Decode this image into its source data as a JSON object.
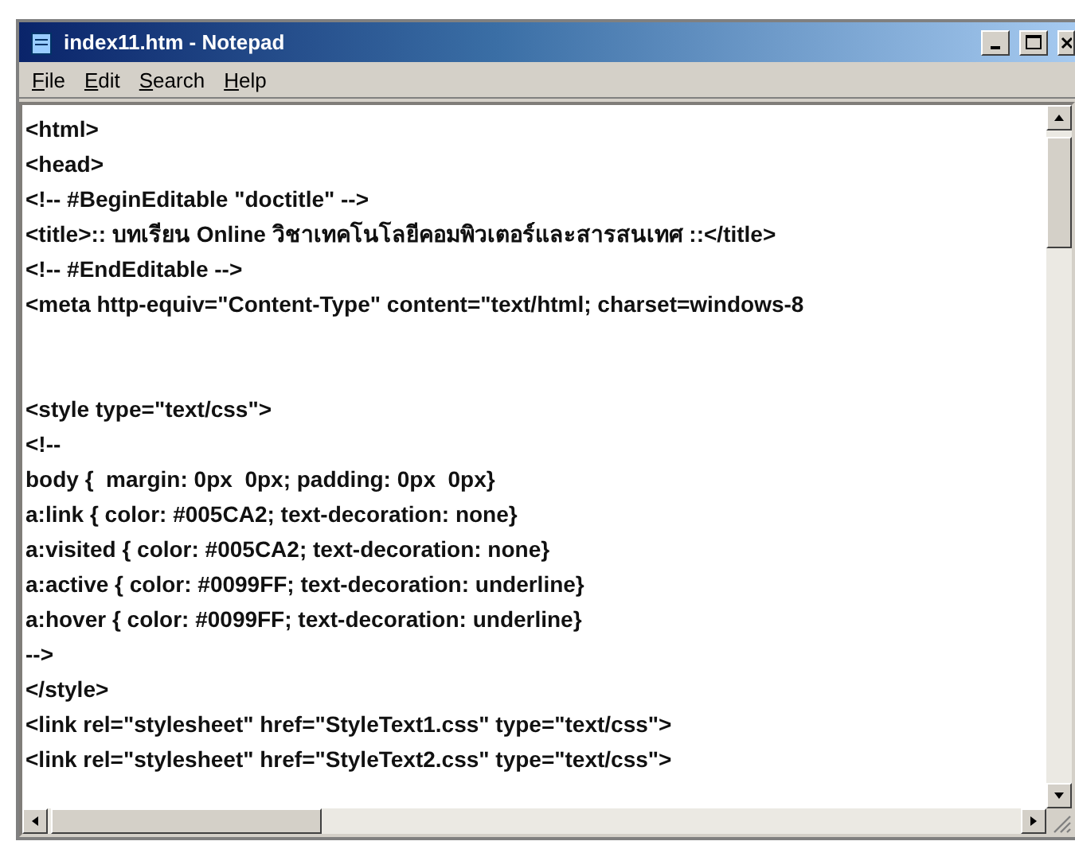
{
  "window": {
    "title": "index11.htm - Notepad"
  },
  "menu": [
    "File",
    "Edit",
    "Search",
    "Help"
  ],
  "lines": [
    {
      "kind": "code",
      "text": "<html>"
    },
    {
      "kind": "code",
      "text": "<head>"
    },
    {
      "kind": "code",
      "text": "<!-- #BeginEditable \"doctitle\" -->"
    },
    {
      "kind": "code",
      "text": "<title>:: บทเรียน Online วิชาเทคโนโลยีคอมพิวเตอร์และสารสนเทศ ::</title>"
    },
    {
      "kind": "code",
      "text": "<!-- #EndEditable -->"
    },
    {
      "kind": "code",
      "text": "<meta http-equiv=\"Content-Type\" content=\"text/html; charset=windows-8"
    },
    {
      "kind": "blank"
    },
    {
      "kind": "blank"
    },
    {
      "kind": "code",
      "text": "<style type=\"text/css\">"
    },
    {
      "kind": "code",
      "text": "<!--"
    },
    {
      "kind": "code",
      "text": "body {  margin: 0px  0px; padding: 0px  0px}"
    },
    {
      "kind": "code",
      "text": "a:link { color: #005CA2; text-decoration: none}"
    },
    {
      "kind": "code",
      "text": "a:visited { color: #005CA2; text-decoration: none}"
    },
    {
      "kind": "code",
      "text": "a:active { color: #0099FF; text-decoration: underline}"
    },
    {
      "kind": "code",
      "text": "a:hover { color: #0099FF; text-decoration: underline}"
    },
    {
      "kind": "code",
      "text": "-->"
    },
    {
      "kind": "code",
      "text": "</style>"
    },
    {
      "kind": "code",
      "text": "<link rel=\"stylesheet\" href=\"StyleText1.css\" type=\"text/css\">"
    },
    {
      "kind": "code",
      "text": "<link rel=\"stylesheet\" href=\"StyleText2.css\" type=\"text/css\">"
    }
  ]
}
